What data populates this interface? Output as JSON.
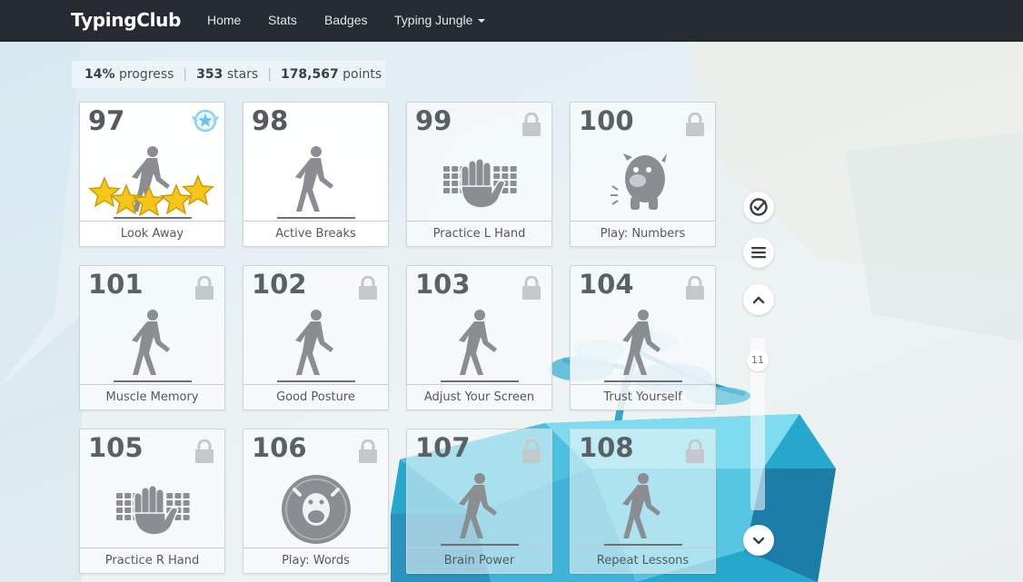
{
  "app": {
    "brand": "TypingClub"
  },
  "nav": {
    "home": "Home",
    "stats": "Stats",
    "badges": "Badges",
    "jungle": "Typing Jungle"
  },
  "progress": {
    "percent": "14%",
    "percent_label": "progress",
    "stars": "353",
    "stars_label": "stars",
    "points": "178,567",
    "points_label": "points"
  },
  "lessons": [
    {
      "num": "97",
      "label": "Look Away",
      "locked": false,
      "icon": "walking-person-icon",
      "stars_earned": 5
    },
    {
      "num": "98",
      "label": "Active Breaks",
      "locked": false,
      "icon": "walking-person-icon"
    },
    {
      "num": "99",
      "label": "Practice L Hand",
      "locked": true,
      "icon": "keyboard-hand-icon"
    },
    {
      "num": "100",
      "label": "Play: Numbers",
      "locked": true,
      "icon": "monster-icon"
    },
    {
      "num": "101",
      "label": "Muscle Memory",
      "locked": true,
      "icon": "walking-person-icon"
    },
    {
      "num": "102",
      "label": "Good Posture",
      "locked": true,
      "icon": "walking-person-icon"
    },
    {
      "num": "103",
      "label": "Adjust Your Screen",
      "locked": true,
      "icon": "walking-person-icon"
    },
    {
      "num": "104",
      "label": "Trust Yourself",
      "locked": true,
      "icon": "walking-person-icon"
    },
    {
      "num": "105",
      "label": "Practice R Hand",
      "locked": true,
      "icon": "keyboard-hand-icon"
    },
    {
      "num": "106",
      "label": "Play: Words",
      "locked": true,
      "icon": "game-bubble-icon"
    },
    {
      "num": "107",
      "label": "Brain Power",
      "locked": true,
      "icon": "walking-person-icon"
    },
    {
      "num": "108",
      "label": "Repeat Lessons",
      "locked": true,
      "icon": "walking-person-icon"
    }
  ],
  "sidebar": {
    "page": "11",
    "buttons": [
      "check-circle-icon",
      "menu-icon",
      "chevron-up-icon",
      "chevron-down-icon"
    ]
  },
  "colors": {
    "navbar": "#252b31",
    "star": "#f5c518",
    "icon_gray": "#8a8e92",
    "crystal": "#1fa7c9"
  }
}
